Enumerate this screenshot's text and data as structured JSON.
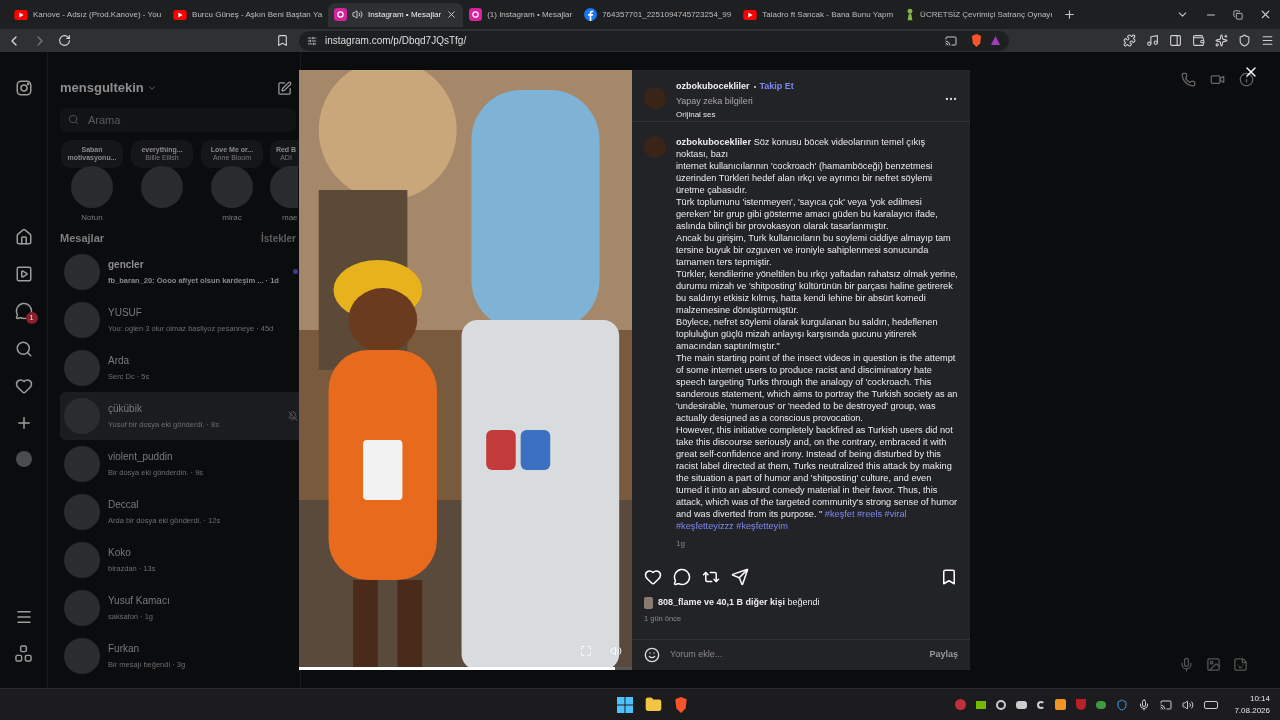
{
  "browser": {
    "tabs": [
      {
        "title": "Kanove - Adsız (Prod.Kanove) - You",
        "kind": "youtube",
        "selected": false,
        "audio": false
      },
      {
        "title": "Burcu Güneş - Aşkın Beni Baştan Ya",
        "kind": "youtube",
        "selected": false,
        "audio": false
      },
      {
        "title": "Instagram • Mesajlar",
        "kind": "instagram",
        "selected": true,
        "audio": true
      },
      {
        "title": "(1) Instagram • Mesajlar",
        "kind": "instagram",
        "selected": false,
        "audio": false
      },
      {
        "title": "764357701_2251094745723254_99",
        "kind": "facebook",
        "selected": false,
        "audio": false
      },
      {
        "title": "Taladro ft Sancak - Bana Bunu Yapm",
        "kind": "youtube",
        "selected": false,
        "audio": false
      },
      {
        "title": "ÜCRETSİZ Çevrimiçi Satranç Oynayı",
        "kind": "chess",
        "selected": false,
        "audio": false
      }
    ],
    "url": "instagram.com/p/Dbqd7JQsTfg/"
  },
  "sidebar": {
    "badge": "1"
  },
  "inbox": {
    "username": "mensgultekin",
    "search": {
      "placeholder": "Arama"
    },
    "notes": [
      {
        "note": "Saban motivasyonu...",
        "name": "Notun"
      },
      {
        "note": "everything...",
        "subtitle": "Billie Eilish"
      },
      {
        "note": "Love Me or...",
        "subtitle": "Anne Bloom",
        "name": "mirac"
      },
      {
        "note": "Red B",
        "subtitle": "ADI",
        "name": "mae"
      }
    ],
    "heading": "Mesajlar",
    "requests": "İstekler",
    "conversations": [
      {
        "name": "gencler",
        "preview": "fb_baran_20: Oooo afiyet olsun kardeşim ... · 1d",
        "unread": true,
        "selected": false,
        "muted": false
      },
      {
        "name": "YUSUF",
        "preview": "You: oglen 3 olur olmaz basliyoz pesanneye · 45d",
        "unread": false,
        "selected": false,
        "muted": false
      },
      {
        "name": "Arda",
        "preview": "Serc Dc · 5s",
        "unread": false,
        "selected": false,
        "muted": false
      },
      {
        "name": "çükübik",
        "preview": "Yusuf bir dosya eki gönderdi. · 8s",
        "unread": false,
        "selected": true,
        "muted": true
      },
      {
        "name": "violent_puddin",
        "preview": "Bir dosya eki gönderdin. · 9s",
        "unread": false,
        "selected": false,
        "muted": false
      },
      {
        "name": "Deccal",
        "preview": "Arda bir dosya eki gönderdi. · 12s",
        "unread": false,
        "selected": false,
        "muted": false
      },
      {
        "name": "Koko",
        "preview": "birazdan · 13s",
        "unread": false,
        "selected": false,
        "muted": false
      },
      {
        "name": "Yusuf Kamacı",
        "preview": "saksafon · 1g",
        "unread": false,
        "selected": false,
        "muted": false
      },
      {
        "name": "Furkan",
        "preview": "Bir mesajı beğendi · 3g",
        "unread": false,
        "selected": false,
        "muted": false
      }
    ]
  },
  "post": {
    "video": {
      "kind": "picture",
      "level": 0.95
    },
    "author": "ozbokubocekliler",
    "follow": "Takip Et",
    "ai_label": "Yapay zeka bilgileri",
    "audio": "Orijinal ses",
    "caption_author": "ozbokubocekliler",
    "caption": [
      "Söz konusu böcek videolarının temel çıkış noktası, bazı",
      "internet kullanıcılarının 'cockroach' (hamamböceği) benzetmesi üzerinden Türkleri hedef alan ırkçı ve ayrımcı bir nefret söylemi üretme çabasıdır.",
      "Türk toplumunu 'istenmeyen', 'sayıca çok' veya 'yok edilmesi gereken' bir grup gibi gösterme amacı güden bu karalayıcı ifade, aslında bilinçli bir provokasyon olarak tasarlanmıştır.",
      "Ancak bu girişim, Turk kullanıcıların bu soylemi ciddiye almayıp tam tersine buyuk bir ozguven ve ironiyle sahiplenmesi sonucunda tamamen ters tepmiştir.",
      "Türkler, kendilerine yöneltilen bu ırkçı yaftadan rahatsız olmak yerine, durumu mizah ve 'shitposting' kültürünün bir parçası haline getirerek bu saldırıyı etkisiz kılmış, hatta kendi lehine bir absürt komedi malzemesine dönüştürmüştür.",
      "Böylece, nefret söylemi olarak kurgulanan bu saldırı, hedeflenen topluluğun güçlü mizah anlayışı karşısında gucunu yitirerek amacından saptırılmıştır.\"",
      "The main starting point of the insect videos in question is the attempt of some internet users to produce racist and disciminatory hate speech targeting Turks through the analogy of 'cockroach. This sanderous statement, which aims to portray the Turkish society as an",
      "'undesirable, 'numerous' or 'needed to be destroyed' group, was actually designed as a conscious provocation.",
      "However, this initiative completely backfired as Turkish users did not take this discourse seriously and, on the contrary, embraced it with great self-confidence and irony. Instead of being disturbed by this racist label directed at them, Turks neutralized this attack by making the situation a part of humor and 'shitposting' culture, and even turned it into an absurd comedy material in their favor. Thus, this attack, which was of the targeted community's strong sense of humor and was diverted from its purpose. \""
    ],
    "hashtags": [
      "#keşfet",
      "#reels",
      "#viral",
      "#keşfetteyizzz",
      "#keşfetteyim"
    ],
    "age": "1g",
    "likes": "**808_flame ve 40,1 B diğer kişi** beğendi",
    "date": "1 gün önce",
    "comment": {
      "placeholder": "Yorum ekle..."
    },
    "share": "Paylaş"
  },
  "taskbar": {
    "time": "10:14",
    "date": "7.08.2026"
  }
}
